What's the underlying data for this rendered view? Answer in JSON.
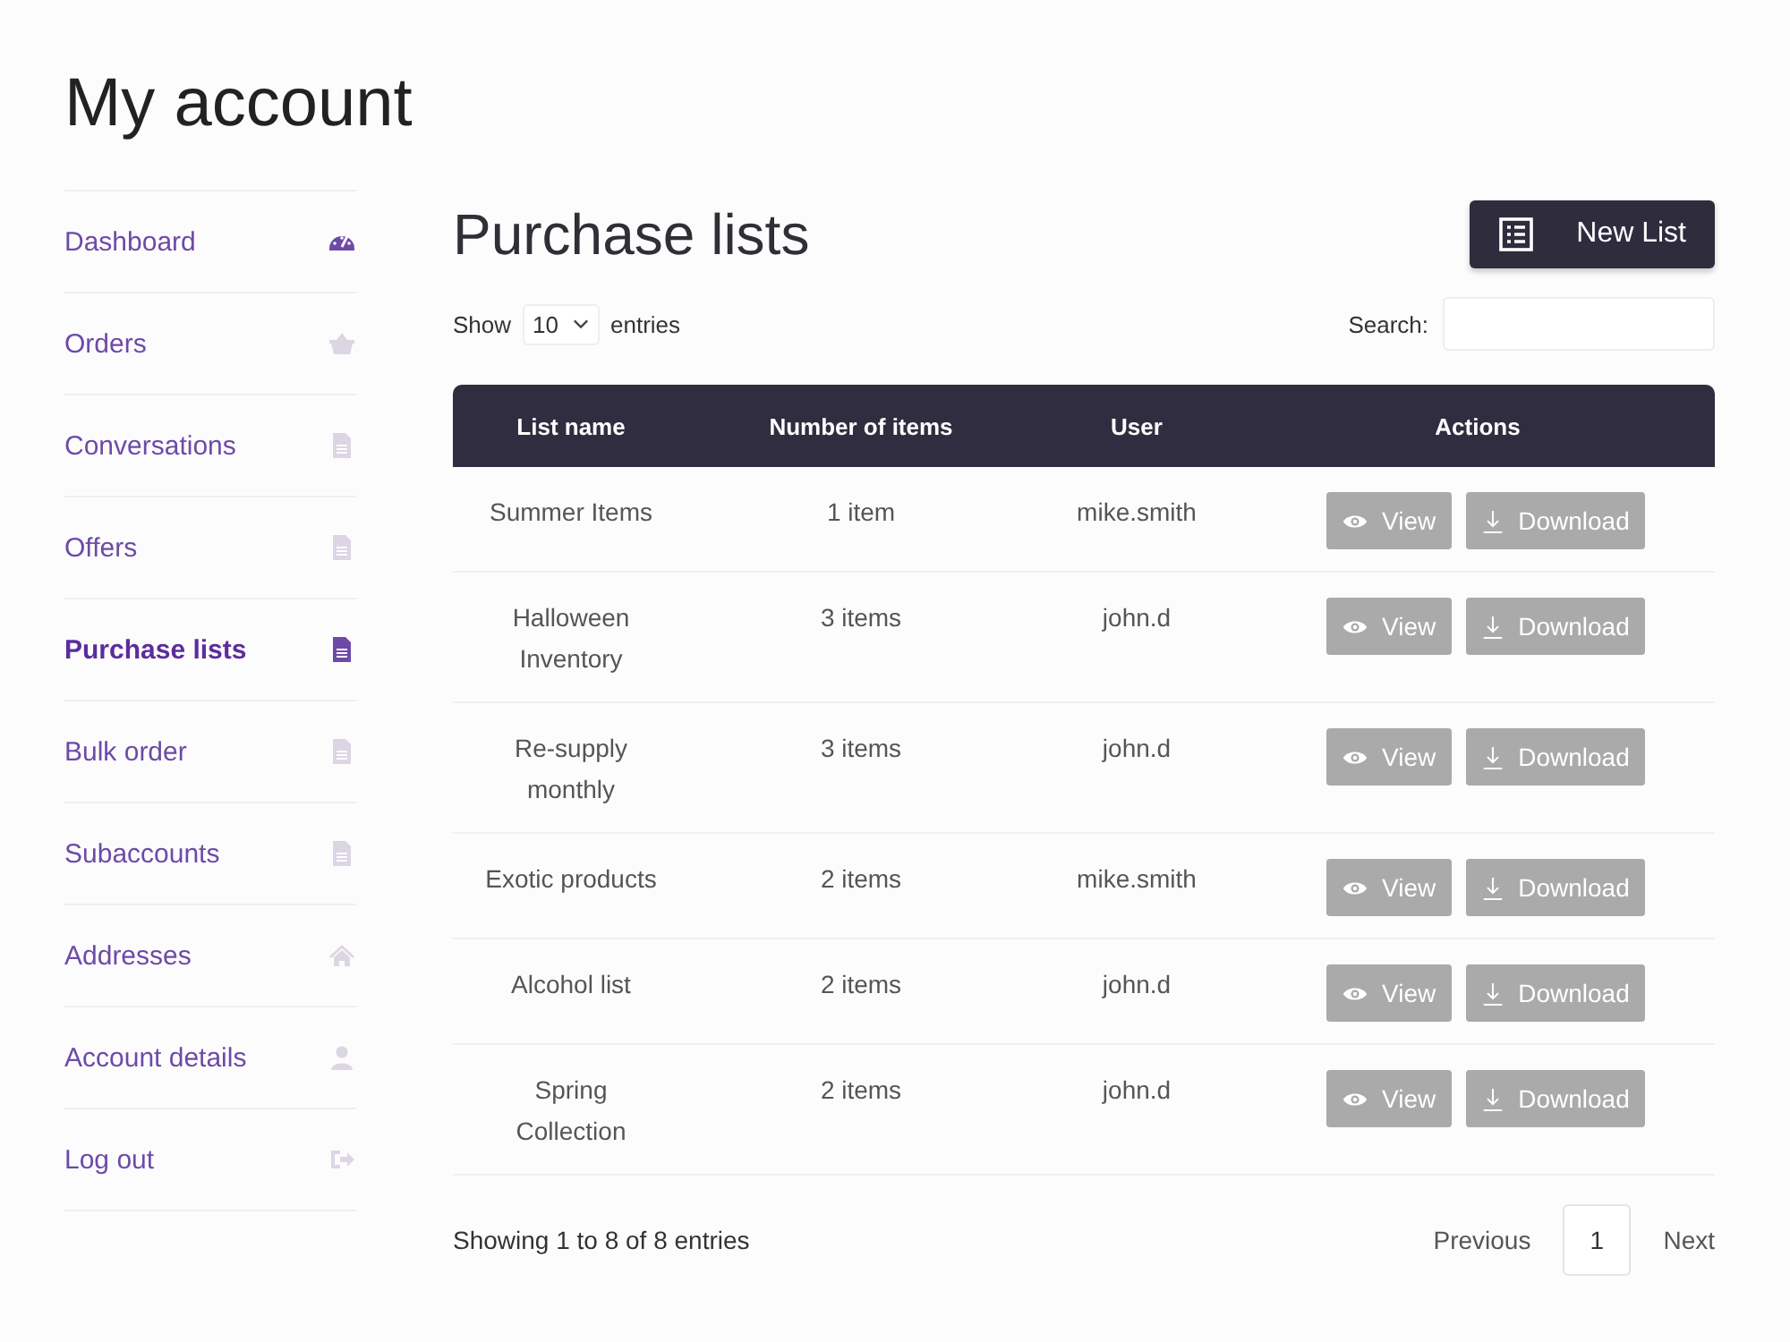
{
  "page_title": "My account",
  "sidebar": {
    "items": [
      {
        "label": "Dashboard",
        "kind": "gauge",
        "selected": false,
        "icon_active": true
      },
      {
        "label": "Orders",
        "kind": "basket",
        "selected": false,
        "icon_active": false
      },
      {
        "label": "Conversations",
        "kind": "document",
        "selected": false,
        "icon_active": false
      },
      {
        "label": "Offers",
        "kind": "document",
        "selected": false,
        "icon_active": false
      },
      {
        "label": "Purchase lists",
        "kind": "document",
        "selected": true,
        "icon_active": true
      },
      {
        "label": "Bulk order",
        "kind": "document",
        "selected": false,
        "icon_active": false
      },
      {
        "label": "Subaccounts",
        "kind": "document",
        "selected": false,
        "icon_active": false
      },
      {
        "label": "Addresses",
        "kind": "home",
        "selected": false,
        "icon_active": false
      },
      {
        "label": "Account details",
        "kind": "user",
        "selected": false,
        "icon_active": false
      },
      {
        "label": "Log out",
        "kind": "logout",
        "selected": false,
        "icon_active": false
      }
    ]
  },
  "heading": "Purchase lists",
  "new_list_button": "New List",
  "length_control": {
    "before": "Show",
    "value": "10",
    "after": "entries"
  },
  "search": {
    "label": "Search:"
  },
  "table": {
    "columns": [
      "List name",
      "Number of items",
      "User",
      "Actions"
    ],
    "rows": [
      {
        "name": "Summer Items",
        "items": "1 item",
        "user": "mike.smith",
        "actions": [
          "View",
          "Download"
        ]
      },
      {
        "name": "Halloween Inventory",
        "items": "3 items",
        "user": "john.d",
        "actions": [
          "View",
          "Download"
        ]
      },
      {
        "name": "Re-supply monthly",
        "items": "3 items",
        "user": "john.d",
        "actions": [
          "View",
          "Download"
        ]
      },
      {
        "name": "Exotic products",
        "items": "2 items",
        "user": "mike.smith",
        "actions": [
          "View",
          "Download"
        ]
      },
      {
        "name": "Alcohol list",
        "items": "2 items",
        "user": "john.d",
        "actions": [
          "View",
          "Download"
        ]
      },
      {
        "name": "Spring Collection",
        "items": "2 items",
        "user": "john.d",
        "actions": [
          "View",
          "Download"
        ]
      }
    ]
  },
  "info": "Showing 1 to 8 of 8 entries",
  "pagination": {
    "previous": "Previous",
    "pages": [
      {
        "label": "1",
        "selected": true
      }
    ],
    "next": "Next"
  }
}
